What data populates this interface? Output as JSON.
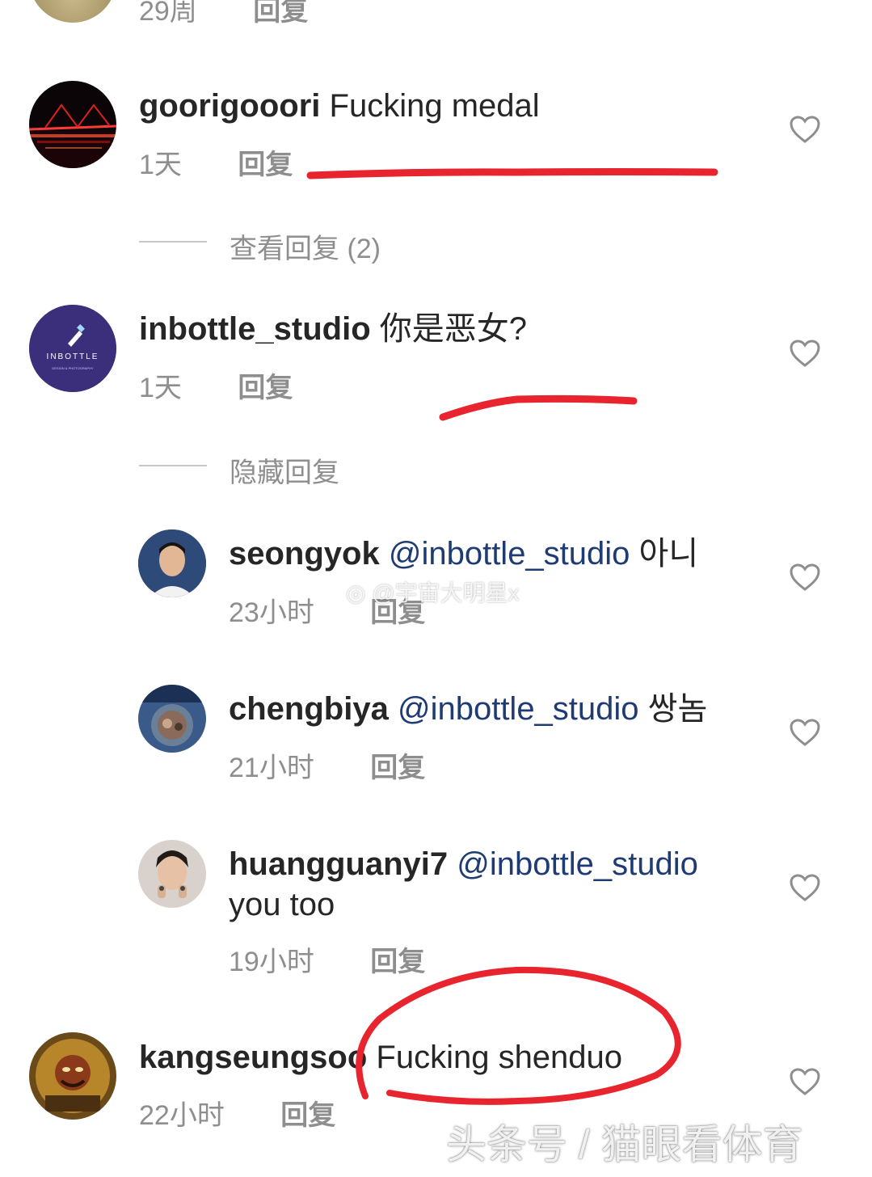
{
  "top_partial": {
    "time": "29周",
    "reply": "回复"
  },
  "comments": [
    {
      "user": "goorigooori",
      "text": "Fucking medal",
      "time": "1天",
      "reply": "回复"
    },
    {
      "user": "inbottle_studio",
      "text": "你是恶女?",
      "time": "1天",
      "reply": "回复",
      "avatar_logo": "INBOTTLE",
      "avatar_tagline": "DESIGN & PHOTOGRAPHY"
    },
    {
      "user": "kangseungsoo",
      "text": "Fucking shenduo",
      "time": "22小时",
      "reply": "回复"
    }
  ],
  "thread_toggles": {
    "view_replies": "查看回复 (2)",
    "hide_replies": "隐藏回复"
  },
  "replies": [
    {
      "user": "seongyok",
      "mention": "@inbottle_studio",
      "text": "아니",
      "time": "23小时",
      "reply": "回复"
    },
    {
      "user": "chengbiya",
      "mention": "@inbottle_studio",
      "text": "쌍놈",
      "time": "21小时",
      "reply": "回复"
    },
    {
      "user": "huangguanyi7",
      "mention": "@inbottle_studio",
      "text": "you too",
      "time": "19小时",
      "reply": "回复"
    }
  ],
  "watermarks": {
    "weibo": "@宇宙大明星x",
    "bottom": "头条号 / 猫眼看体育"
  },
  "colors": {
    "annotation_red": "#e8242e",
    "mention_blue": "#1f3b73",
    "secondary_gray": "#8e8e8e"
  },
  "icons": {
    "like": "heart-outline-icon",
    "weibo": "weibo-logo-icon"
  }
}
